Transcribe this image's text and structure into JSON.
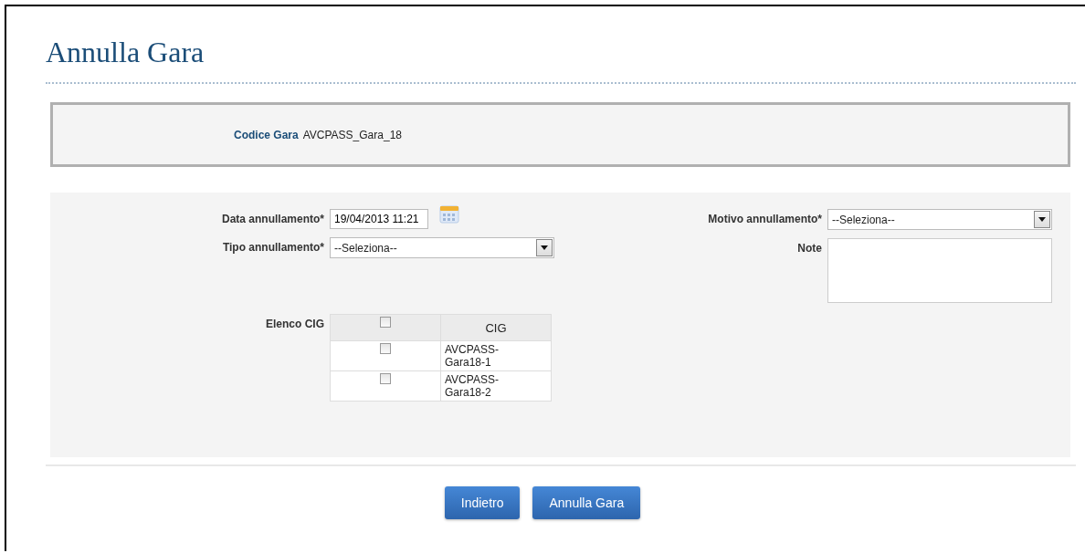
{
  "title": "Annulla Gara",
  "header": {
    "label": "Codice Gara",
    "value": "AVCPASS_Gara_18"
  },
  "form": {
    "data_annullamento": {
      "label": "Data annullamento*",
      "value": "19/04/2013 11:21"
    },
    "tipo_annullamento": {
      "label": "Tipo annullamento*",
      "value": "--Seleziona--"
    },
    "motivo_annullamento": {
      "label": "Motivo annullamento*",
      "value": "--Seleziona--"
    },
    "note": {
      "label": "Note"
    },
    "elenco_cig": {
      "label": "Elenco CIG",
      "select_all_checked": false,
      "column": "CIG",
      "rows": [
        {
          "cig": "AVCPASS-Gara18-1",
          "checked": false
        },
        {
          "cig": "AVCPASS-Gara18-2",
          "checked": false
        }
      ]
    }
  },
  "buttons": [
    {
      "label": "Indietro"
    },
    {
      "label": "Annulla Gara"
    }
  ]
}
